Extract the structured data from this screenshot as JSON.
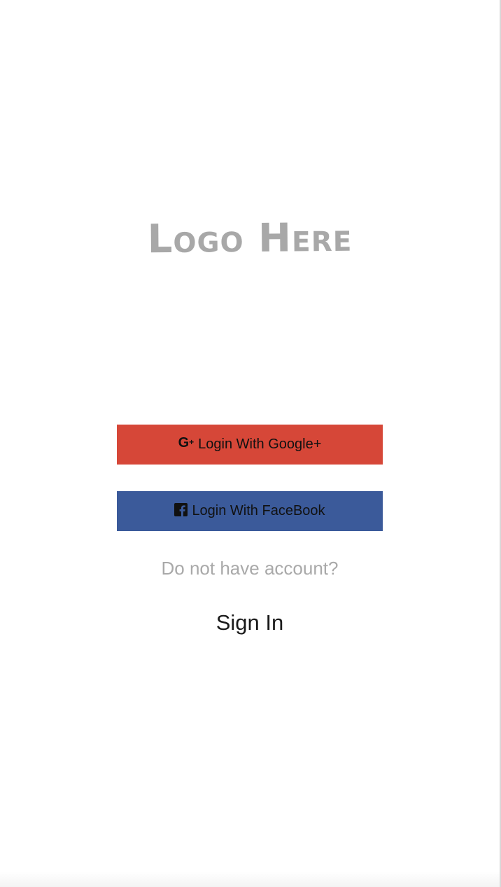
{
  "logo": {
    "text": "Logo Here",
    "color": "#a8a8a8"
  },
  "buttons": {
    "google": {
      "icon": "google-plus-icon",
      "icon_glyph": "G",
      "icon_plus": "+",
      "label": "Login With Google+",
      "color": "#d64738"
    },
    "facebook": {
      "icon": "facebook-icon",
      "label": "Login With FaceBook",
      "color": "#3b5a9a"
    }
  },
  "prompt": {
    "text": "Do not have account?"
  },
  "sign_in": {
    "label": "Sign In"
  }
}
